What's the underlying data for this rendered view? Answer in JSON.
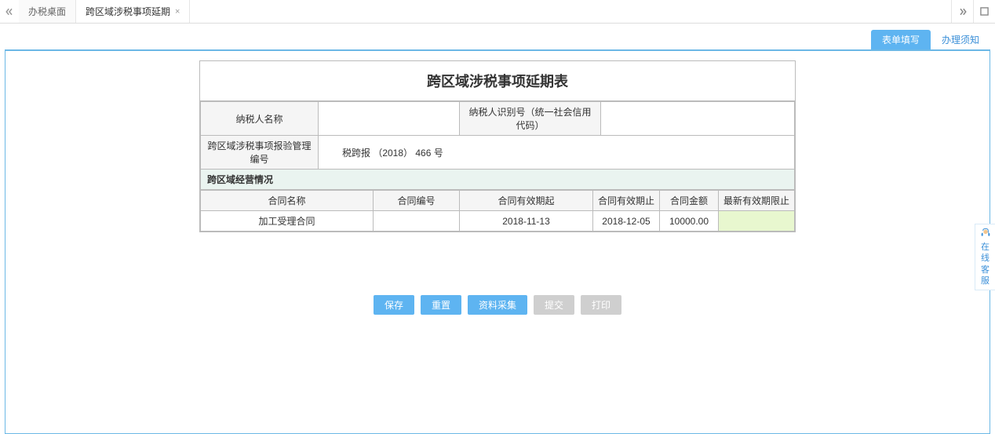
{
  "tabs": {
    "tab1": "办税桌面",
    "tab2": "跨区域涉税事项延期"
  },
  "sub_tabs": {
    "form_fill": "表单填写",
    "process_notice": "办理须知"
  },
  "form": {
    "title": "跨区域涉税事项延期表",
    "labels": {
      "taxpayer_name": "纳税人名称",
      "taxpayer_id": "纳税人识别号（统一社会信用代码）",
      "report_mgmt_no": "跨区域涉税事项报验管理编号",
      "section_header": "跨区域经营情况"
    },
    "values": {
      "taxpayer_name": "",
      "taxpayer_id": "",
      "report_mgmt_no": "税跨报 （2018） 466 号"
    },
    "columns": {
      "contract_name": "合同名称",
      "contract_no": "合同编号",
      "valid_from": "合同有效期起",
      "valid_to": "合同有效期止",
      "amount": "合同金额",
      "new_deadline": "最新有效期限止"
    },
    "rows": [
      {
        "contract_name": "加工受理合同",
        "contract_no": "",
        "valid_from": "2018-11-13",
        "valid_to": "2018-12-05",
        "amount": "10000.00",
        "new_deadline": ""
      }
    ]
  },
  "buttons": {
    "save": "保存",
    "reset": "重置",
    "collect": "资料采集",
    "submit": "提交",
    "print": "打印"
  },
  "customer_service": "在线客服"
}
